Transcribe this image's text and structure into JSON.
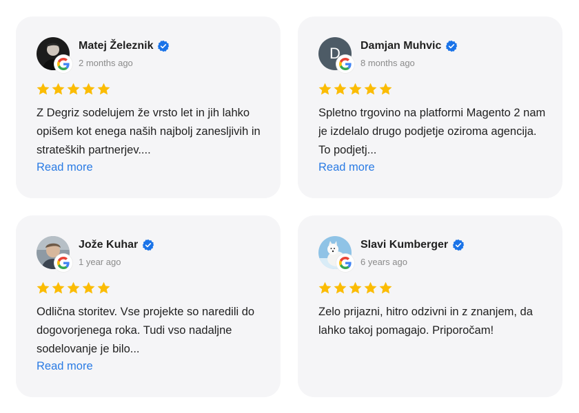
{
  "reviews": [
    {
      "name": "Matej Železnik",
      "date": "2 months ago",
      "rating": 5,
      "text": "Z Degriz sodelujem že vrsto let in jih lahko opišem kot enega naših najbolj zanesljivih in strateških partnerjev....",
      "read_more": "Read more",
      "avatar": "photo-man-dark"
    },
    {
      "name": "Damjan Muhvic",
      "date": "8 months ago",
      "rating": 5,
      "text": "Spletno trgovino na platformi Magento 2 nam je izdelalo drugo podjetje oziroma agencija. To podjetj...",
      "read_more": "Read more",
      "avatar_letter": "D"
    },
    {
      "name": "Jože Kuhar",
      "date": "1 year ago",
      "rating": 5,
      "text": "Odlična storitev. Vse projekte so naredili do dogovorjenega roka. Tudi vso nadaljne sodelovanje je bilo...",
      "read_more": "Read more",
      "avatar": "photo-man-light"
    },
    {
      "name": "Slavi Kumberger",
      "date": "6 years ago",
      "rating": 5,
      "text": "Zelo prijazni, hitro odzivni in z znanjem, da lahko takoj pomagajo. Priporočam!",
      "avatar": "photo-white-dog"
    }
  ],
  "colors": {
    "card_bg": "#f5f5f7",
    "star": "#fbbc04",
    "verified": "#1a73e8",
    "link": "#2a7be4"
  },
  "icons": {
    "badge": "google-g-icon",
    "verified": "verified-check-icon",
    "star": "star-icon"
  }
}
